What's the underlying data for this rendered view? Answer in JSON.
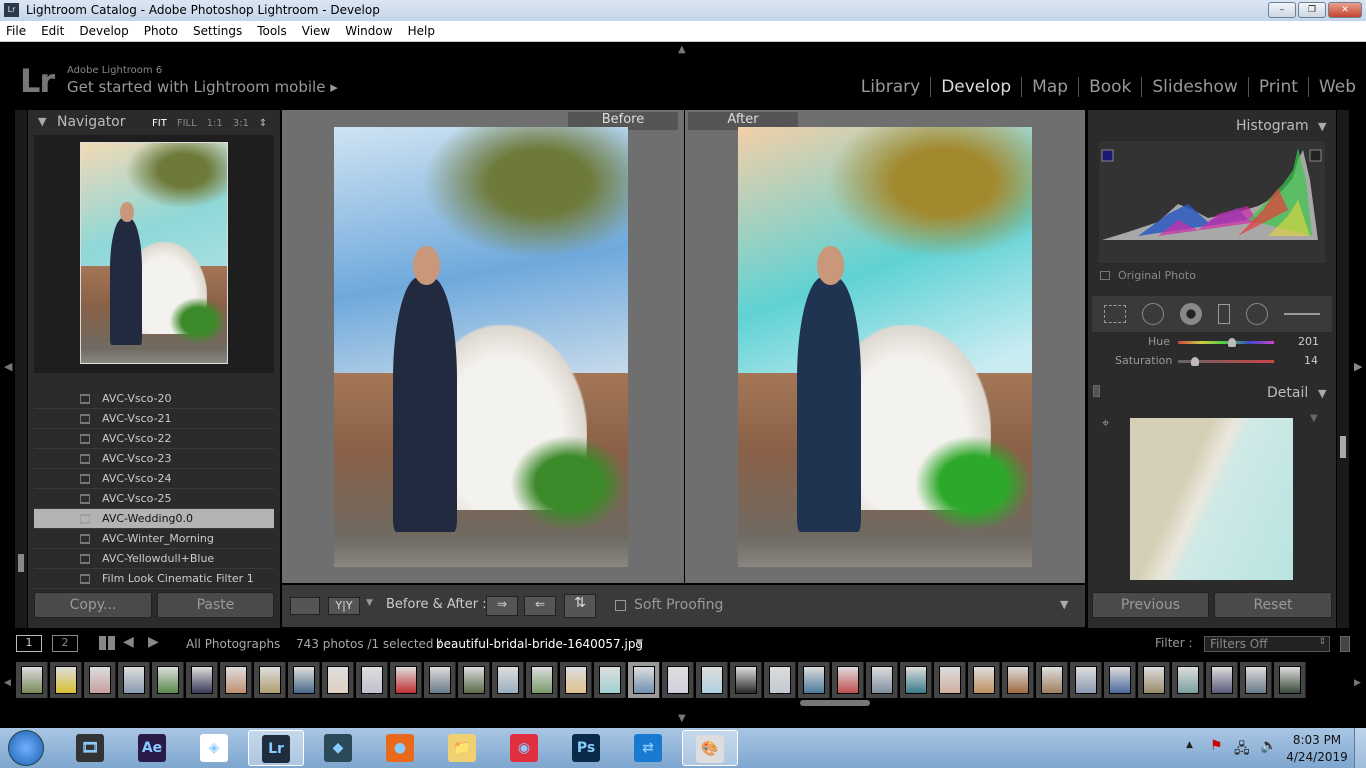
{
  "window": {
    "title": "Lightroom Catalog - Adobe Photoshop Lightroom - Develop",
    "app_icon": "Lr"
  },
  "menu": [
    "File",
    "Edit",
    "Develop",
    "Photo",
    "Settings",
    "Tools",
    "View",
    "Window",
    "Help"
  ],
  "header": {
    "logo": "Lr",
    "product": "Adobe Lightroom 6",
    "mobile": "Get started with Lightroom mobile ▸"
  },
  "modules": [
    "Library",
    "Develop",
    "Map",
    "Book",
    "Slideshow",
    "Print",
    "Web"
  ],
  "active_module": "Develop",
  "navigator": {
    "title": "Navigator",
    "zoom": [
      "FIT",
      "FILL",
      "1:1",
      "3:1"
    ],
    "selected_zoom": "FIT"
  },
  "presets": [
    "AVC-Vsco-20",
    "AVC-Vsco-21",
    "AVC-Vsco-22",
    "AVC-Vsco-23",
    "AVC-Vsco-24",
    "AVC-Vsco-25",
    "AVC-Wedding0.0",
    "AVC-Winter_Morning",
    "AVC-Yellowdull+Blue",
    "Film Look Cinematic Filter 1"
  ],
  "selected_preset": "AVC-Wedding0.0",
  "left_buttons": {
    "copy": "Copy...",
    "paste": "Paste"
  },
  "view": {
    "before": "Before",
    "after": "After"
  },
  "toolbar": {
    "before_after": "Before & After :",
    "soft_proofing": "Soft Proofing",
    "yy": "Y|Y"
  },
  "histogram": {
    "title": "Histogram",
    "original_photo": "Original Photo"
  },
  "hsl": {
    "hue_label": "Hue",
    "hue": "201",
    "saturation_label": "Saturation",
    "saturation": "14"
  },
  "detail": {
    "title": "Detail"
  },
  "right_buttons": {
    "previous": "Previous",
    "reset": "Reset"
  },
  "filmbar": {
    "view1": "1",
    "view2": "2",
    "source": "All Photographs",
    "count": "743 photos /1 selected /",
    "filename": "beautiful-bridal-bride-1640057.jpg",
    "filter_label": "Filter :",
    "filter_value": "Filters Off"
  },
  "taskbar": {
    "apps": [
      "Media",
      "Ae",
      "Sketch",
      "Lr",
      "Filmora",
      "Firefox",
      "Explorer",
      "Recorder",
      "Ps",
      "TeamViewer",
      "Paint"
    ],
    "time": "8:03 PM",
    "date": "4/24/2019"
  },
  "colors": {
    "panel": "#2b2b2b",
    "canvas": "#6f6f6f",
    "selected_preset": "#b3b3b3"
  }
}
